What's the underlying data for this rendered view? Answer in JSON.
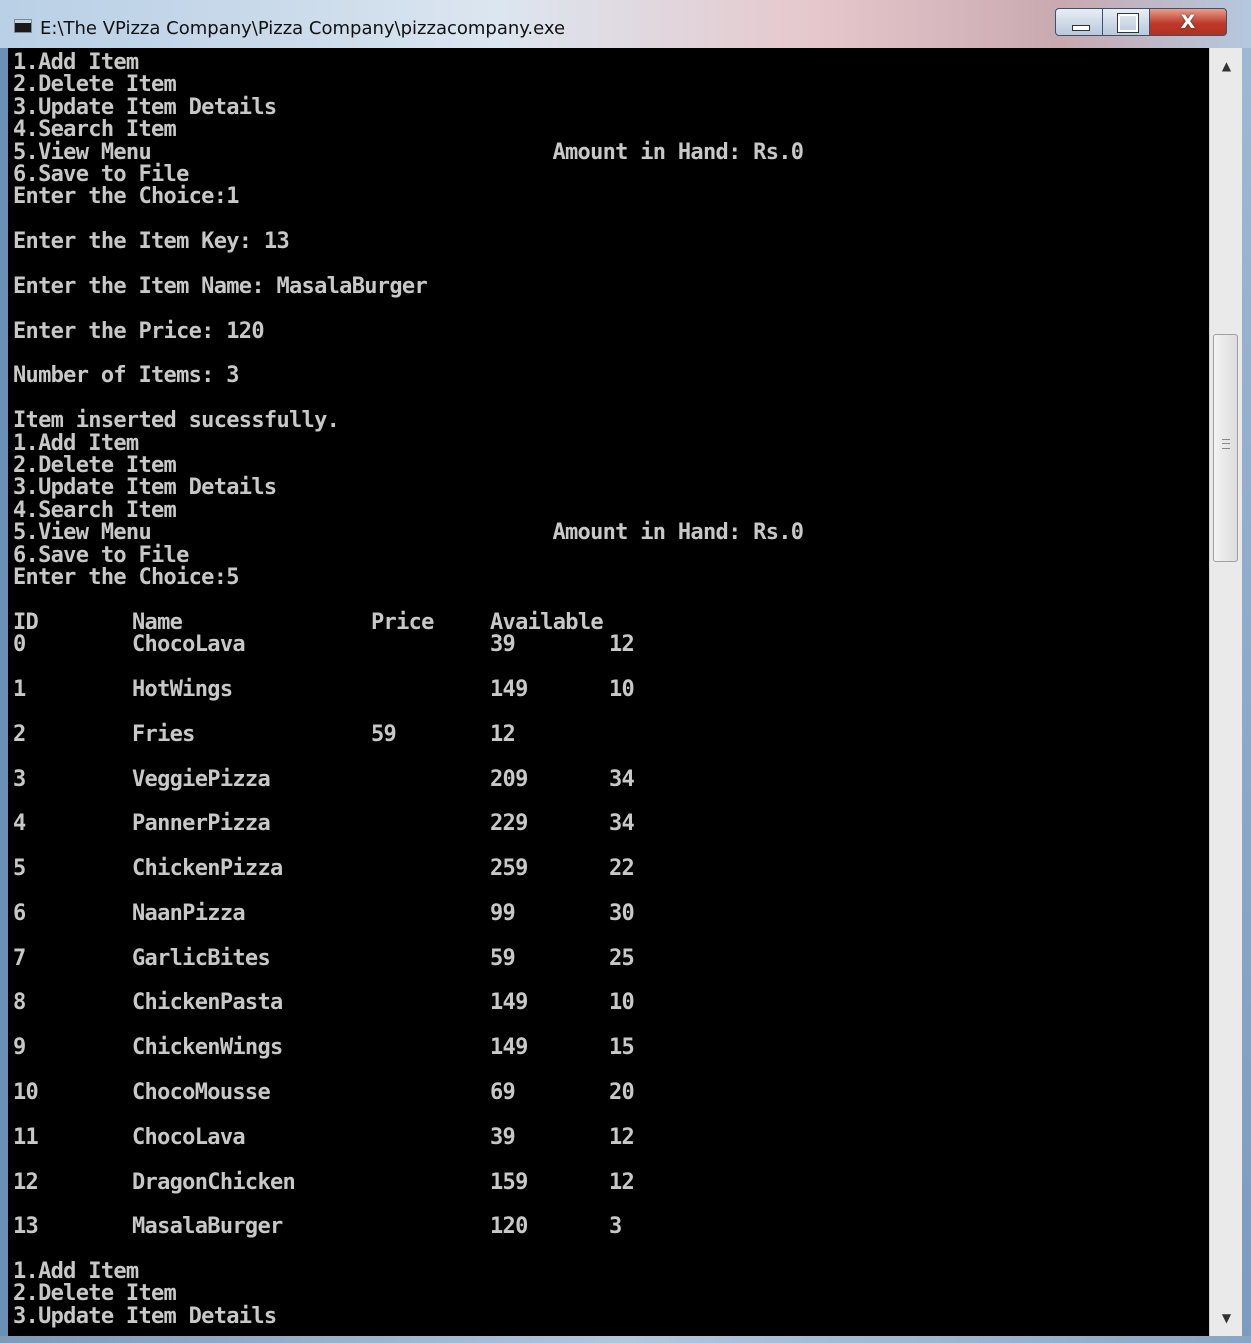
{
  "window": {
    "title": "E:\\The VPizza Company\\Pizza Company\\pizzacompany.exe",
    "close_glyph": "X"
  },
  "console": {
    "lines_top": [
      "1.Add Item",
      "2.Delete Item",
      "3.Update Item Details",
      "4.Search Item",
      "5.View Menu                                Amount in Hand: Rs.0",
      "6.Save to File",
      "Enter the Choice:1",
      "",
      "Enter the Item Key: 13",
      "",
      "Enter the Item Name: MasalaBurger",
      "",
      "Enter the Price: 120",
      "",
      "Number of Items: 3",
      "",
      "Item inserted sucessfully.",
      "1.Add Item",
      "2.Delete Item",
      "3.Update Item Details",
      "4.Search Item",
      "5.View Menu                                Amount in Hand: Rs.0",
      "6.Save to File",
      "Enter the Choice:5",
      ""
    ],
    "table_header": [
      "ID",
      "Name",
      "Price",
      "Available"
    ],
    "table_rows": [
      {
        "id": "0",
        "name": "ChocoLava",
        "c3": "",
        "c4": "39",
        "c5": "12"
      },
      {
        "id": "1",
        "name": "HotWings",
        "c3": "",
        "c4": "149",
        "c5": "10"
      },
      {
        "id": "2",
        "name": "Fries",
        "c3": "59",
        "c4": "12",
        "c5": ""
      },
      {
        "id": "3",
        "name": "VeggiePizza",
        "c3": "",
        "c4": "209",
        "c5": "34"
      },
      {
        "id": "4",
        "name": "PannerPizza",
        "c3": "",
        "c4": "229",
        "c5": "34"
      },
      {
        "id": "5",
        "name": "ChickenPizza",
        "c3": "",
        "c4": "259",
        "c5": "22"
      },
      {
        "id": "6",
        "name": "NaanPizza",
        "c3": "",
        "c4": "99",
        "c5": "30"
      },
      {
        "id": "7",
        "name": "GarlicBites",
        "c3": "",
        "c4": "59",
        "c5": "25"
      },
      {
        "id": "8",
        "name": "ChickenPasta",
        "c3": "",
        "c4": "149",
        "c5": "10"
      },
      {
        "id": "9",
        "name": "ChickenWings",
        "c3": "",
        "c4": "149",
        "c5": "15"
      },
      {
        "id": "10",
        "name": "ChocoMousse",
        "c3": "",
        "c4": "69",
        "c5": "20"
      },
      {
        "id": "11",
        "name": "ChocoLava",
        "c3": "",
        "c4": "39",
        "c5": "12"
      },
      {
        "id": "12",
        "name": "DragonChicken",
        "c3": "",
        "c4": "159",
        "c5": "12"
      },
      {
        "id": "13",
        "name": "MasalaBurger",
        "c3": "",
        "c4": "120",
        "c5": "3"
      }
    ],
    "lines_bottom": [
      "",
      "1.Add Item",
      "2.Delete Item",
      "3.Update Item Details"
    ]
  },
  "colors": {
    "console_bg": "#000000",
    "console_text": "#c8c8c8"
  },
  "icons": {
    "app": "console-icon",
    "minimize": "minimize-icon",
    "maximize": "maximize-icon",
    "close": "close-icon",
    "scroll_up": "scroll-up-arrow-icon",
    "scroll_down": "scroll-down-arrow-icon"
  }
}
